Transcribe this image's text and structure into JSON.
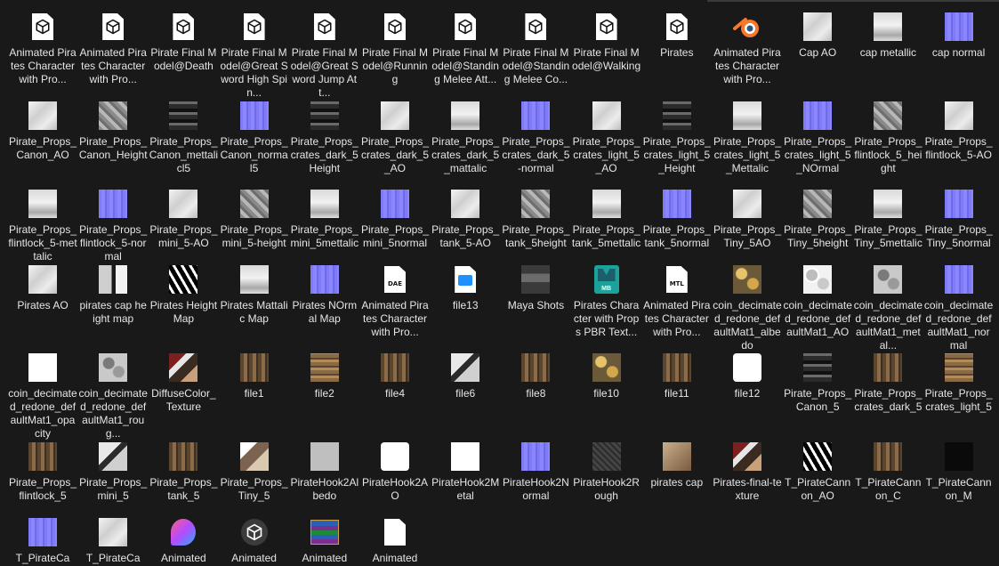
{
  "items": [
    {
      "label": "Animated Pirates Character with Pro...",
      "icon": "model-file-icon",
      "thumb": "cube"
    },
    {
      "label": "Animated Pirates Character with Pro...",
      "icon": "model-file-icon",
      "thumb": "cube"
    },
    {
      "label": "Pirate Final Model@Death",
      "icon": "model-file-icon",
      "thumb": "cube"
    },
    {
      "label": "Pirate Final Model@Great Sword High Spin...",
      "icon": "model-file-icon",
      "thumb": "cube"
    },
    {
      "label": "Pirate Final Model@Great Sword Jump Att...",
      "icon": "model-file-icon",
      "thumb": "cube"
    },
    {
      "label": "Pirate Final Model@Running",
      "icon": "model-file-icon",
      "thumb": "cube"
    },
    {
      "label": "Pirate Final Model@Standing Melee Att...",
      "icon": "model-file-icon",
      "thumb": "cube"
    },
    {
      "label": "Pirate Final Model@Standing Melee Co...",
      "icon": "model-file-icon",
      "thumb": "cube"
    },
    {
      "label": "Pirate Final Model@Walking",
      "icon": "model-file-icon",
      "thumb": "cube"
    },
    {
      "label": "Pirates",
      "icon": "model-file-icon",
      "thumb": "cube"
    },
    {
      "label": "Animated Pirates Character with Pro...",
      "icon": "blender-icon",
      "thumb": "blender"
    },
    {
      "label": "Cap AO",
      "icon": "texture-thumbnail",
      "thumb": "t-ao"
    },
    {
      "label": "cap metallic",
      "icon": "texture-thumbnail",
      "thumb": "t-metal"
    },
    {
      "label": "cap normal",
      "icon": "texture-thumbnail",
      "thumb": "t-normal"
    },
    {
      "label": "Pirate_Props_Canon_AO",
      "icon": "texture-thumbnail",
      "thumb": "t-ao"
    },
    {
      "label": "Pirate_Props_Canon_Height",
      "icon": "texture-thumbnail",
      "thumb": "t-height"
    },
    {
      "label": "Pirate_Props_Canon_mettalicl5",
      "icon": "texture-thumbnail",
      "thumb": "t-dark"
    },
    {
      "label": "Pirate_Props_Canon_normal5",
      "icon": "texture-thumbnail",
      "thumb": "t-normal"
    },
    {
      "label": "Pirate_Props_crates_dark_5 Height",
      "icon": "texture-thumbnail",
      "thumb": "t-dark"
    },
    {
      "label": "Pirate_Props_crates_dark_5_AO",
      "icon": "texture-thumbnail",
      "thumb": "t-ao"
    },
    {
      "label": "Pirate_Props_crates_dark_5_mattalic",
      "icon": "texture-thumbnail",
      "thumb": "t-metal"
    },
    {
      "label": "Pirate_Props_crates_dark_5-normal",
      "icon": "texture-thumbnail",
      "thumb": "t-normal"
    },
    {
      "label": "Pirate_Props_crates_light_5_AO",
      "icon": "texture-thumbnail",
      "thumb": "t-ao"
    },
    {
      "label": "Pirate_Props_crates_light_5_Height",
      "icon": "texture-thumbnail",
      "thumb": "t-dark"
    },
    {
      "label": "Pirate_Props_crates_light_5_Mettalic",
      "icon": "texture-thumbnail",
      "thumb": "t-metal"
    },
    {
      "label": "Pirate_Props_crates_light_5_NOrmal",
      "icon": "texture-thumbnail",
      "thumb": "t-normal"
    },
    {
      "label": "Pirate_Props_flintlock_5_height",
      "icon": "texture-thumbnail",
      "thumb": "t-height"
    },
    {
      "label": "Pirate_Props_flintlock_5-AO",
      "icon": "texture-thumbnail",
      "thumb": "t-ao"
    },
    {
      "label": "Pirate_Props_flintlock_5-mettalic",
      "icon": "texture-thumbnail",
      "thumb": "t-metal"
    },
    {
      "label": "Pirate_Props_flintlock_5-normal",
      "icon": "texture-thumbnail",
      "thumb": "t-normal"
    },
    {
      "label": "Pirate_Props_mini_5-AO",
      "icon": "texture-thumbnail",
      "thumb": "t-ao"
    },
    {
      "label": "Pirate_Props_mini_5-height",
      "icon": "texture-thumbnail",
      "thumb": "t-height"
    },
    {
      "label": "Pirate_Props_mini_5mettalic",
      "icon": "texture-thumbnail",
      "thumb": "t-metal"
    },
    {
      "label": "Pirate_Props_mini_5normal",
      "icon": "texture-thumbnail",
      "thumb": "t-normal"
    },
    {
      "label": "Pirate_Props_tank_5-AO",
      "icon": "texture-thumbnail",
      "thumb": "t-ao"
    },
    {
      "label": "Pirate_Props_tank_5height",
      "icon": "texture-thumbnail",
      "thumb": "t-height"
    },
    {
      "label": "Pirate_Props_tank_5mettalic",
      "icon": "texture-thumbnail",
      "thumb": "t-metal"
    },
    {
      "label": "Pirate_Props_tank_5normal",
      "icon": "texture-thumbnail",
      "thumb": "t-normal"
    },
    {
      "label": "Pirate_Props_Tiny_5AO",
      "icon": "texture-thumbnail",
      "thumb": "t-ao"
    },
    {
      "label": "Pirate_Props_Tiny_5height",
      "icon": "texture-thumbnail",
      "thumb": "t-height"
    },
    {
      "label": "Pirate_Props_Tiny_5mettalic",
      "icon": "texture-thumbnail",
      "thumb": "t-metal"
    },
    {
      "label": "Pirate_Props_Tiny_5normal",
      "icon": "texture-thumbnail",
      "thumb": "t-normal"
    },
    {
      "label": "Pirates AO",
      "icon": "texture-thumbnail",
      "thumb": "t-ao"
    },
    {
      "label": "pirates cap height map",
      "icon": "texture-thumbnail",
      "thumb": "t-caps"
    },
    {
      "label": "Pirates Height Map",
      "icon": "texture-thumbnail",
      "thumb": "t-bw"
    },
    {
      "label": "Pirates Mattalic Map",
      "icon": "texture-thumbnail",
      "thumb": "t-metal"
    },
    {
      "label": "Pirates NOrmal Map",
      "icon": "texture-thumbnail",
      "thumb": "t-normal"
    },
    {
      "label": "Animated Pirates Character with Pro...",
      "icon": "dae-file-icon",
      "thumb": "file",
      "tag": "DAE"
    },
    {
      "label": "file13",
      "icon": "image-file-icon",
      "thumb": "file",
      "tag": "IMG"
    },
    {
      "label": "Maya Shots",
      "icon": "texture-thumbnail",
      "thumb": "t-maya"
    },
    {
      "label": "Pirates Character with Props PBR Text...",
      "icon": "maya-icon",
      "thumb": "maya"
    },
    {
      "label": "Animated Pirates Character with Pro...",
      "icon": "mtl-file-icon",
      "thumb": "file",
      "tag": "MTL"
    },
    {
      "label": "coin_decimated_redone_defaultMat1_albedo",
      "icon": "texture-thumbnail",
      "thumb": "t-coin"
    },
    {
      "label": "coin_decimated_redone_defaultMat1_AO",
      "icon": "texture-thumbnail",
      "thumb": "t-coin-ao"
    },
    {
      "label": "coin_decimated_redone_defaultMat1_metal...",
      "icon": "texture-thumbnail",
      "thumb": "t-coin-metal"
    },
    {
      "label": "coin_decimated_redone_defaultMat1_normal",
      "icon": "texture-thumbnail",
      "thumb": "t-normal"
    },
    {
      "label": "coin_decimated_redone_defaultMat1_opacity",
      "icon": "texture-thumbnail",
      "thumb": "t-white"
    },
    {
      "label": "coin_decimated_redone_defaultMat1_roug...",
      "icon": "texture-thumbnail",
      "thumb": "t-coin-metal"
    },
    {
      "label": "DiffuseColor_Texture",
      "icon": "texture-thumbnail",
      "thumb": "t-mix"
    },
    {
      "label": "file1",
      "icon": "texture-thumbnail",
      "thumb": "t-wood"
    },
    {
      "label": "file2",
      "icon": "texture-thumbnail",
      "thumb": "t-crate-light"
    },
    {
      "label": "file4",
      "icon": "texture-thumbnail",
      "thumb": "t-wood"
    },
    {
      "label": "file6",
      "icon": "texture-thumbnail",
      "thumb": "t-mini"
    },
    {
      "label": "file8",
      "icon": "texture-thumbnail",
      "thumb": "t-wood"
    },
    {
      "label": "file10",
      "icon": "texture-thumbnail",
      "thumb": "t-coin"
    },
    {
      "label": "file11",
      "icon": "texture-thumbnail",
      "thumb": "t-wood"
    },
    {
      "label": "file12",
      "icon": "texture-thumbnail",
      "thumb": "t-hook"
    },
    {
      "label": "Pirate_Props_Canon_5",
      "icon": "texture-thumbnail",
      "thumb": "t-dark"
    },
    {
      "label": "Pirate_Props_crates_dark_5",
      "icon": "texture-thumbnail",
      "thumb": "t-wood"
    },
    {
      "label": "Pirate_Props_crates_light_5",
      "icon": "texture-thumbnail",
      "thumb": "t-crate-light"
    },
    {
      "label": "Pirate_Props_flintlock_5",
      "icon": "texture-thumbnail",
      "thumb": "t-wood"
    },
    {
      "label": "Pirate_Props_mini_5",
      "icon": "texture-thumbnail",
      "thumb": "t-mini"
    },
    {
      "label": "Pirate_Props_tank_5",
      "icon": "texture-thumbnail",
      "thumb": "t-wood"
    },
    {
      "label": "Pirate_Props_Tiny_5",
      "icon": "texture-thumbnail",
      "thumb": "t-tiny"
    },
    {
      "label": "PirateHook2Albedo",
      "icon": "texture-thumbnail",
      "thumb": "t-grey"
    },
    {
      "label": "PirateHook2AO",
      "icon": "texture-thumbnail",
      "thumb": "t-hook"
    },
    {
      "label": "PirateHook2Metal",
      "icon": "texture-thumbnail",
      "thumb": "t-white"
    },
    {
      "label": "PirateHook2Normal",
      "icon": "texture-thumbnail",
      "thumb": "t-normal"
    },
    {
      "label": "PirateHook2Rough",
      "icon": "texture-thumbnail",
      "thumb": "t-rough"
    },
    {
      "label": "pirates cap",
      "icon": "texture-thumbnail",
      "thumb": "t-pirate-cap"
    },
    {
      "label": "Pirates-final-texture",
      "icon": "texture-thumbnail",
      "thumb": "t-mix"
    },
    {
      "label": "T_PirateCannon_AO",
      "icon": "texture-thumbnail",
      "thumb": "t-bw"
    },
    {
      "label": "T_PirateCannon_C",
      "icon": "texture-thumbnail",
      "thumb": "t-wood"
    },
    {
      "label": "T_PirateCannon_M",
      "icon": "texture-thumbnail",
      "thumb": "t-black"
    },
    {
      "label": "T_PirateCa",
      "icon": "texture-thumbnail",
      "thumb": "t-normal"
    },
    {
      "label": "T_PirateCa",
      "icon": "texture-thumbnail",
      "thumb": "t-ao"
    },
    {
      "label": "Animated",
      "icon": "paint3d-icon",
      "thumb": "paint3d"
    },
    {
      "label": "Animated",
      "icon": "unity-icon",
      "thumb": "unity"
    },
    {
      "label": "Animated",
      "icon": "winrar-icon",
      "thumb": "winrar"
    },
    {
      "label": "Animated",
      "icon": "blank-file-icon",
      "thumb": "file",
      "tag": ""
    }
  ]
}
